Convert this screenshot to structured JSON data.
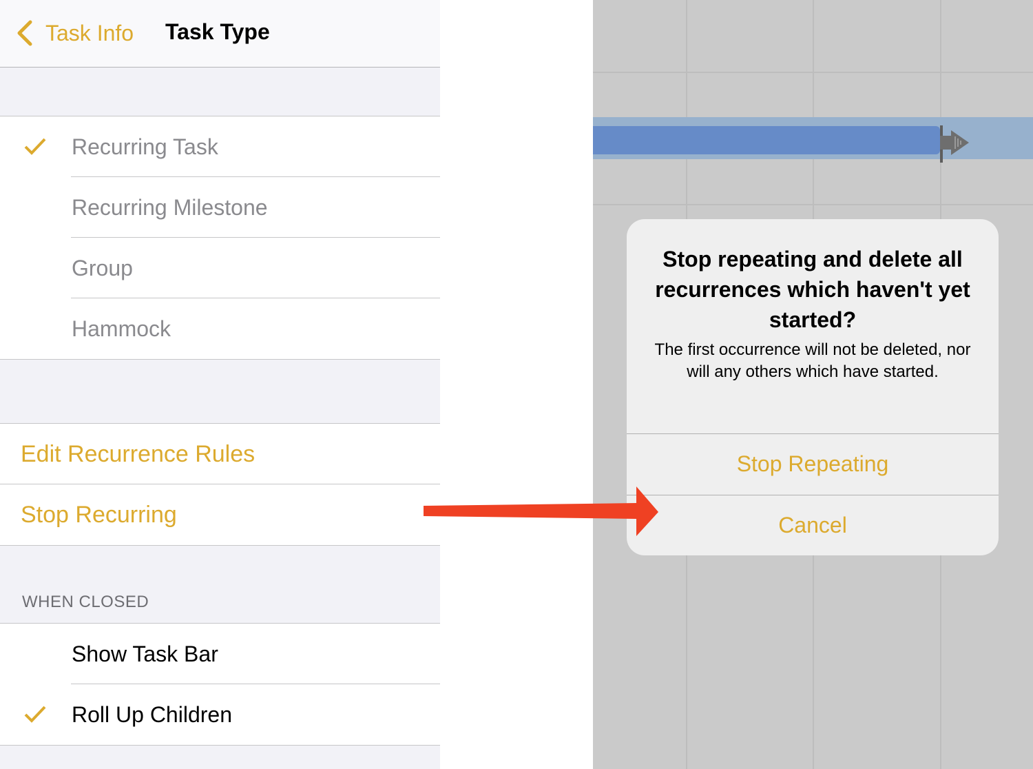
{
  "navbar": {
    "back_label": "Task Info",
    "title": "Task Type",
    "back_icon": "chevron-left-icon"
  },
  "task_types": [
    {
      "label": "Recurring Task",
      "checked": true
    },
    {
      "label": "Recurring Milestone",
      "checked": false
    },
    {
      "label": "Group",
      "checked": false
    },
    {
      "label": "Hammock",
      "checked": false
    }
  ],
  "recurrence_actions": [
    {
      "label": "Edit Recurrence Rules"
    },
    {
      "label": "Stop Recurring"
    }
  ],
  "when_closed": {
    "header": "WHEN CLOSED",
    "options": [
      {
        "label": "Show Task Bar",
        "checked": false
      },
      {
        "label": "Roll Up Children",
        "checked": true
      }
    ]
  },
  "alert": {
    "title": "Stop repeating and delete all recurrences which haven't yet started?",
    "message": "The first occurrence will not be deleted, nor will any others which have started.",
    "buttons": [
      {
        "label": "Stop Repeating"
      },
      {
        "label": "Cancel"
      }
    ]
  },
  "colors": {
    "accent": "#dcaa2e",
    "annotation_arrow": "#ef4123",
    "task_bar": "#668bc8",
    "selected_row_band": "#97b1cd",
    "gantt_background": "#cacaca"
  }
}
